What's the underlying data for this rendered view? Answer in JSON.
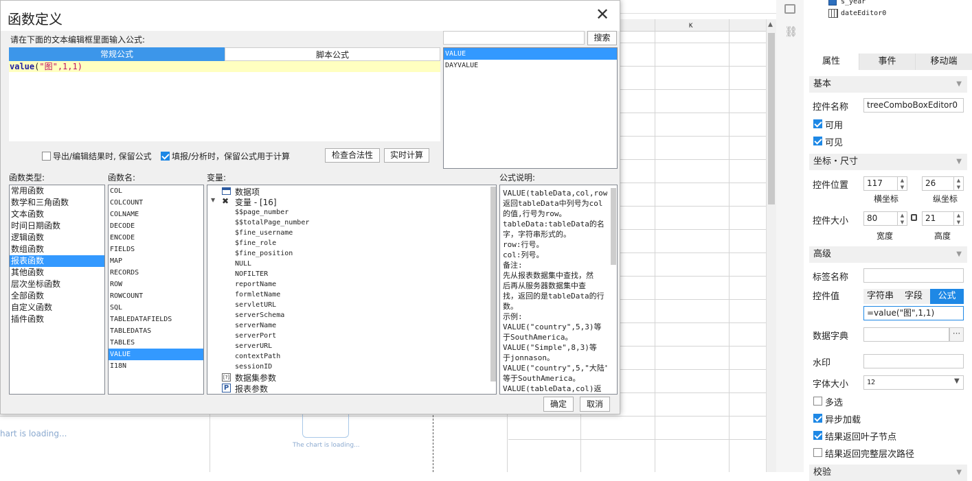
{
  "dialog": {
    "title": "函数定义",
    "instruction": "请在下面的文本编辑框里面输入公式:",
    "tabs": [
      "常规公式",
      "脚本公式"
    ],
    "formula": "value(\"图\",1,1)",
    "formula_parts": {
      "name": "value",
      "open": "(",
      "str": "\"图\"",
      "rest": ",1,1)"
    },
    "search_value": "",
    "search_button": "搜索",
    "search_results": [
      {
        "label": "VALUE",
        "selected": true
      },
      {
        "label": "DAYVALUE",
        "selected": false
      }
    ],
    "opt_export": {
      "label": "导出/编辑结果时, 保留公式",
      "checked": false
    },
    "opt_fill": {
      "label": "填报/分析时，保留公式用于计算",
      "checked": true
    },
    "check_button": "检查合法性",
    "realtime_button": "实时计算",
    "type_header": "函数类型:",
    "types": [
      {
        "label": "常用函数",
        "selected": false
      },
      {
        "label": "数学和三角函数",
        "selected": false
      },
      {
        "label": "文本函数",
        "selected": false
      },
      {
        "label": "时间日期函数",
        "selected": false
      },
      {
        "label": "逻辑函数",
        "selected": false
      },
      {
        "label": "数组函数",
        "selected": false
      },
      {
        "label": "报表函数",
        "selected": true
      },
      {
        "label": "其他函数",
        "selected": false
      },
      {
        "label": "层次坐标函数",
        "selected": false
      },
      {
        "label": "全部函数",
        "selected": false
      },
      {
        "label": "自定义函数",
        "selected": false
      },
      {
        "label": "插件函数",
        "selected": false
      }
    ],
    "name_header": "函数名:",
    "names": [
      {
        "label": "COL",
        "selected": false
      },
      {
        "label": "COLCOUNT",
        "selected": false
      },
      {
        "label": "COLNAME",
        "selected": false
      },
      {
        "label": "DECODE",
        "selected": false
      },
      {
        "label": "ENCODE",
        "selected": false
      },
      {
        "label": "FIELDS",
        "selected": false
      },
      {
        "label": "MAP",
        "selected": false
      },
      {
        "label": "RECORDS",
        "selected": false
      },
      {
        "label": "ROW",
        "selected": false
      },
      {
        "label": "ROWCOUNT",
        "selected": false
      },
      {
        "label": "SQL",
        "selected": false
      },
      {
        "label": "TABLEDATAFIELDS",
        "selected": false
      },
      {
        "label": "TABLEDATAS",
        "selected": false
      },
      {
        "label": "TABLES",
        "selected": false
      },
      {
        "label": "VALUE",
        "selected": true
      },
      {
        "label": "I18N",
        "selected": false
      }
    ],
    "var_header": "变量:",
    "var_data_item": "数据项",
    "var_group": "变量 - [16]",
    "variables": [
      "$$page_number",
      "$$totalPage_number",
      "$fine_username",
      "$fine_role",
      "$fine_position",
      "NULL",
      "NOFILTER",
      "reportName",
      "formletName",
      "servletURL",
      "serverSchema",
      "serverName",
      "serverPort",
      "serverURL",
      "contextPath",
      "sessionID"
    ],
    "var_dataset_param": "数据集参数",
    "var_report_param": "报表参数",
    "desc_header": "公式说明:",
    "description": [
      "VALUE(tableData,col,row)",
      "返回tableData中列号为col",
      "的值,行号为row。",
      "tableData:tableData的名",
      "字，字符串形式的。",
      "row:行号。",
      "col:列号。",
      "备注:",
      "先从报表数据集中查找，然",
      "后再从服务器数据集中查",
      "找，返回的是tableData的行",
      "数。",
      "示例:",
      "VALUE(\"country\",5,3)等",
      "于SouthAmerica。",
      "VALUE(\"Simple\",8,3)等",
      "于jonnason。",
      "VALUE(\"country\",5,\"大陆\")",
      "等于SouthAmerica。",
      "VALUE(tableData,col)返"
    ],
    "ok_button": "确定",
    "cancel_button": "取消"
  },
  "sheet": {
    "col_k": "K",
    "loading_1": "hart is loading...",
    "loading_2": "The chart is loading..."
  },
  "tree": {
    "item1": "s_year",
    "item2": "dateEditor0"
  },
  "panel": {
    "tabs": [
      "属性",
      "事件",
      "移动端"
    ],
    "basic": "基本",
    "name_label": "控件名称",
    "name_value": "treeComboBoxEditor0",
    "enabled": {
      "label": "可用",
      "checked": true
    },
    "visible": {
      "label": "可见",
      "checked": true
    },
    "coord_size": "坐标・尺寸",
    "pos_label": "控件位置",
    "pos_x": "117",
    "pos_y": "26",
    "x_label": "横坐标",
    "y_label": "纵坐标",
    "size_label": "控件大小",
    "width": "80",
    "height": "21",
    "width_label": "宽度",
    "height_label": "高度",
    "advanced": "高级",
    "tag_label": "标签名称",
    "tag_value": "",
    "value_label": "控件值",
    "value_tabs": [
      "字符串",
      "字段",
      "公式"
    ],
    "value_formula": "=value(\"图\",1,1)",
    "dict_label": "数据字典",
    "dict_value": "",
    "watermark_label": "水印",
    "watermark_value": "",
    "fontsize_label": "字体大小",
    "fontsize_value": "12",
    "multi": {
      "label": "多选",
      "checked": false
    },
    "async": {
      "label": "异步加载",
      "checked": true
    },
    "leaf": {
      "label": "结果返回叶子节点",
      "checked": true
    },
    "fullpath": {
      "label": "结果返回完整层次路径",
      "checked": false
    },
    "validate": "校验"
  }
}
